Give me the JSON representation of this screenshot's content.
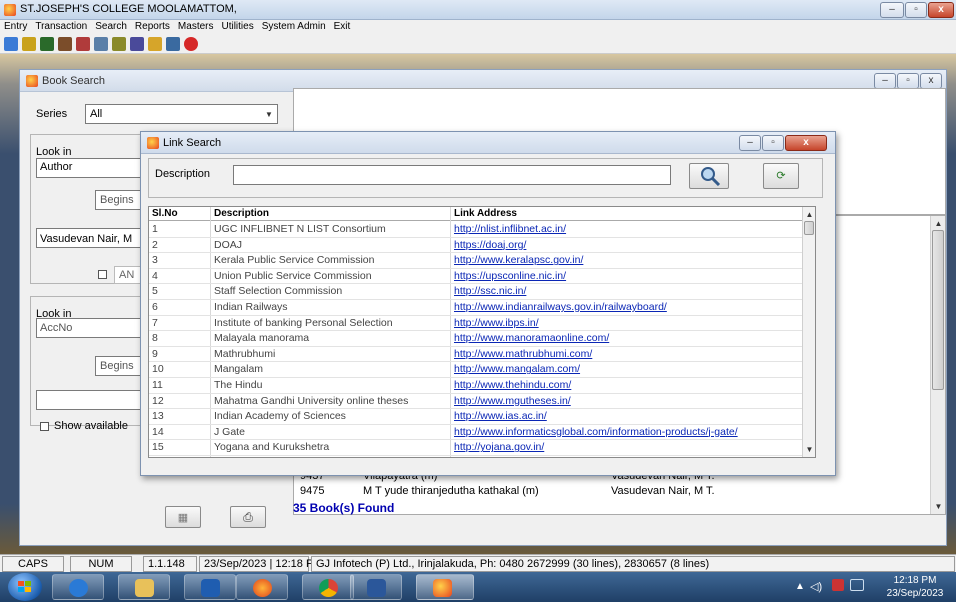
{
  "app": {
    "title": "ST.JOSEPH'S COLLEGE MOOLAMATTOM,",
    "menu": [
      "Entry",
      "Transaction",
      "Search",
      "Reports",
      "Masters",
      "Utilities",
      "System Admin",
      "Exit"
    ]
  },
  "book_search": {
    "title": "Book Search",
    "series_label": "Series",
    "series_value": "All",
    "look_in_label_1": "Look in",
    "look_in_value_1": "Author",
    "begins_1": "Begins",
    "search_value_1": "Vasudevan Nair, M",
    "and_label": "AN",
    "look_in_label_2": "Look in",
    "look_in_value_2": "AccNo",
    "begins_2": "Begins",
    "show_available": "Show available",
    "results_partial": [
      {
        "no": "9437",
        "title": "Vilapayatra (m)",
        "author": "Vasudevan Nair, M T."
      },
      {
        "no": "9475",
        "title": "M T yude thiranjedutha kathakal (m)",
        "author": "Vasudevan Nair, M T."
      }
    ],
    "found": "35 Book(s) Found"
  },
  "link_search": {
    "title": "Link Search",
    "description_label": "Description",
    "description_value": "",
    "columns": [
      "Sl.No",
      "Description",
      "Link Address"
    ],
    "rows": [
      {
        "no": "1",
        "desc": "UGC INFLIBNET N LIST Consortium",
        "link": "http://nlist.inflibnet.ac.in/"
      },
      {
        "no": "2",
        "desc": "DOAJ",
        "link": "https://doaj.org/"
      },
      {
        "no": "3",
        "desc": "Kerala Public Service Commission",
        "link": "http://www.keralapsc.gov.in/"
      },
      {
        "no": "4",
        "desc": "Union Public Service Commission",
        "link": "https://upsconline.nic.in/"
      },
      {
        "no": "5",
        "desc": "Staff Selection Commission",
        "link": "http://ssc.nic.in/"
      },
      {
        "no": "6",
        "desc": "Indian Railways",
        "link": "http://www.indianrailways.gov.in/railwayboard/"
      },
      {
        "no": "7",
        "desc": "Institute of banking Personal Selection",
        "link": "http://www.ibps.in/"
      },
      {
        "no": "8",
        "desc": "Malayala manorama",
        "link": "http://www.manoramaonline.com/"
      },
      {
        "no": "9",
        "desc": "Mathrubhumi",
        "link": "http://www.mathrubhumi.com/"
      },
      {
        "no": "10",
        "desc": "Mangalam",
        "link": "http://www.mangalam.com/"
      },
      {
        "no": "11",
        "desc": "The Hindu",
        "link": "http://www.thehindu.com/"
      },
      {
        "no": "12",
        "desc": "Mahatma Gandhi University online theses",
        "link": "http://www.mgutheses.in/"
      },
      {
        "no": "13",
        "desc": "Indian Academy of Sciences",
        "link": "http://www.ias.ac.in/"
      },
      {
        "no": "14",
        "desc": "J Gate",
        "link": "http://www.informaticsglobal.com/information-products/j-gate/"
      },
      {
        "no": "15",
        "desc": "Yogana and Kurukshetra",
        "link": "http://yojana.gov.in/"
      }
    ]
  },
  "status": {
    "caps": "CAPS",
    "num": "NUM",
    "version": "1.1.148",
    "datetime": "23/Sep/2023 | 12:18 PM",
    "company": "GJ Infotech (P) Ltd., Irinjalakuda, Ph: 0480 2672999 (30 lines), 2830657 (8 lines)"
  },
  "clock": {
    "time": "12:18 PM",
    "date": "23/Sep/2023"
  }
}
